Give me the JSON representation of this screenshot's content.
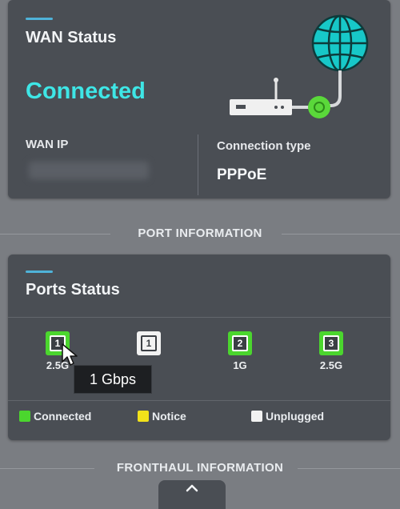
{
  "wan": {
    "title": "WAN Status",
    "status": "Connected",
    "wan_ip_label": "WAN IP",
    "connection_type_label": "Connection type",
    "connection_type_value": "PPPoE"
  },
  "port_information": {
    "heading": "PORT INFORMATION"
  },
  "ports": {
    "title": "Ports Status",
    "items": [
      {
        "number": "1",
        "speed": "2.5G",
        "status": "connected"
      },
      {
        "number": "1",
        "speed": "",
        "status": "unplugged"
      },
      {
        "number": "2",
        "speed": "1G",
        "status": "connected"
      },
      {
        "number": "3",
        "speed": "2.5G",
        "status": "connected"
      }
    ],
    "tooltip": "1 Gbps",
    "legend": [
      {
        "label": "Connected",
        "color": "#4bd62e"
      },
      {
        "label": "Notice",
        "color": "#f2e21a"
      },
      {
        "label": "Unplugged",
        "color": "#f2f2f2"
      }
    ]
  },
  "fronthaul_information": {
    "heading": "FRONTHAUL INFORMATION"
  },
  "icons": [
    "globe-icon",
    "router-icon",
    "link-node-icon",
    "port-icon",
    "chevron-up-icon",
    "mouse-cursor-icon"
  ],
  "colors": {
    "accent": "#4fb3d9",
    "connected_text": "#3ee6e6",
    "connected": "#4bd62e",
    "notice": "#f2e21a",
    "unplugged": "#f2f2f2",
    "globe": "#17c8c8"
  }
}
